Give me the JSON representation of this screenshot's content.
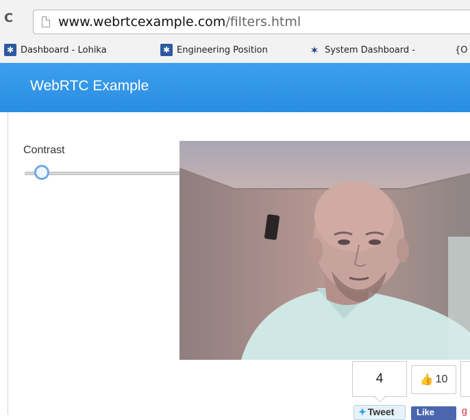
{
  "browser": {
    "url_host": "www.webrtcexample.com",
    "url_path": "/filters.html",
    "bookmarks": [
      {
        "label": "Dashboard - Lohika",
        "icon": "lohika-icon"
      },
      {
        "label": "Engineering Position",
        "icon": "lohika-icon"
      },
      {
        "label": "System Dashboard -",
        "icon": "jira-icon"
      },
      {
        "label": "{O",
        "icon": ""
      }
    ]
  },
  "navbar": {
    "brand": "WebRTC Example",
    "color": "#2f94e6"
  },
  "filters": {
    "contrast_label": "Contrast",
    "contrast_value": 0.1
  },
  "social": {
    "tweet_count": "4",
    "tweet_label": "Tweet",
    "like_count": "10",
    "fb_label": "Like"
  }
}
